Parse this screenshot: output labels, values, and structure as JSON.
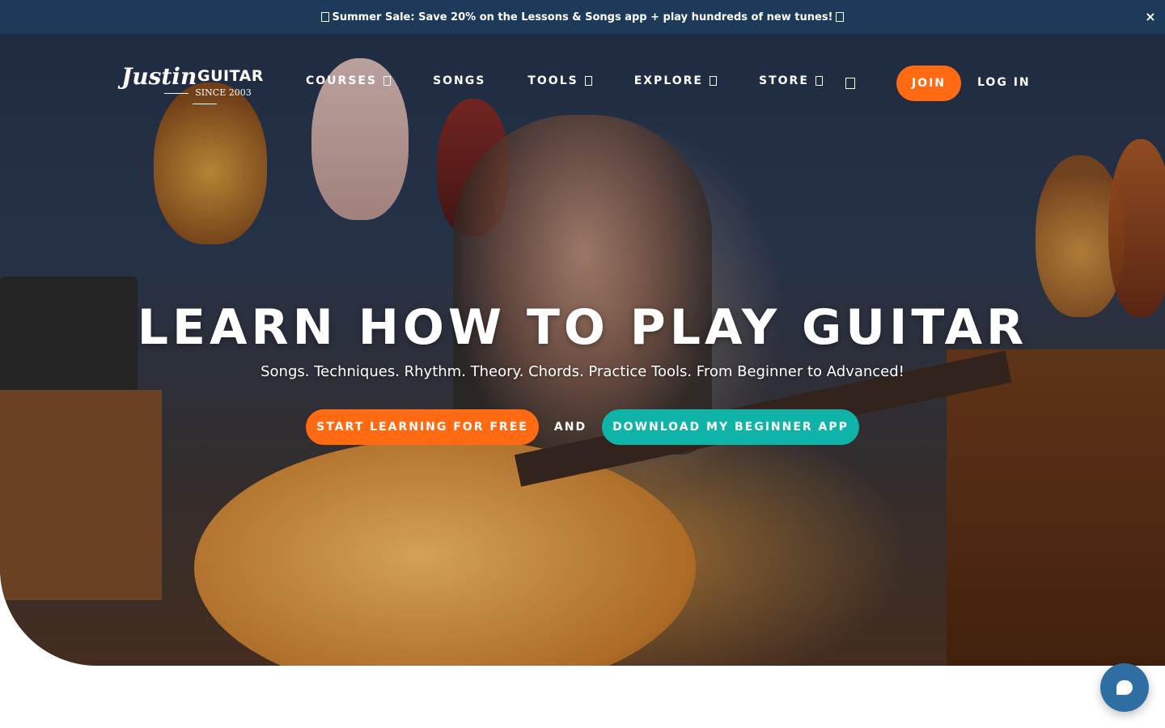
{
  "promo": {
    "text": "Summer Sale: Save 20% on the Lessons & Songs app + play hundreds of new tunes!",
    "close_label": "×"
  },
  "header": {
    "logo": {
      "script": "Justin",
      "word": "GUITAR",
      "since": "SINCE 2003"
    },
    "nav": [
      {
        "label": "COURSES",
        "has_dropdown": true
      },
      {
        "label": "SONGS",
        "has_dropdown": false
      },
      {
        "label": "TOOLS",
        "has_dropdown": true
      },
      {
        "label": "EXPLORE",
        "has_dropdown": true
      },
      {
        "label": "STORE",
        "has_dropdown": true
      }
    ],
    "search_icon": "search-icon",
    "join_label": "JOIN",
    "login_label": "LOG IN"
  },
  "hero": {
    "title": "LEARN HOW TO PLAY GUITAR",
    "subtitle": "Songs. Techniques. Rhythm. Theory. Chords. Practice Tools. From Beginner to Advanced!",
    "cta_primary": "START LEARNING FOR FREE",
    "cta_and": "AND",
    "cta_secondary": "DOWNLOAD MY BEGINNER APP"
  },
  "chat": {
    "icon": "chat-bubble-icon"
  },
  "colors": {
    "promo_bg": "#1d3a5a",
    "accent_orange": "#ff6a13",
    "accent_teal": "#10b3a8",
    "chat_bg": "#2f6ea3"
  }
}
